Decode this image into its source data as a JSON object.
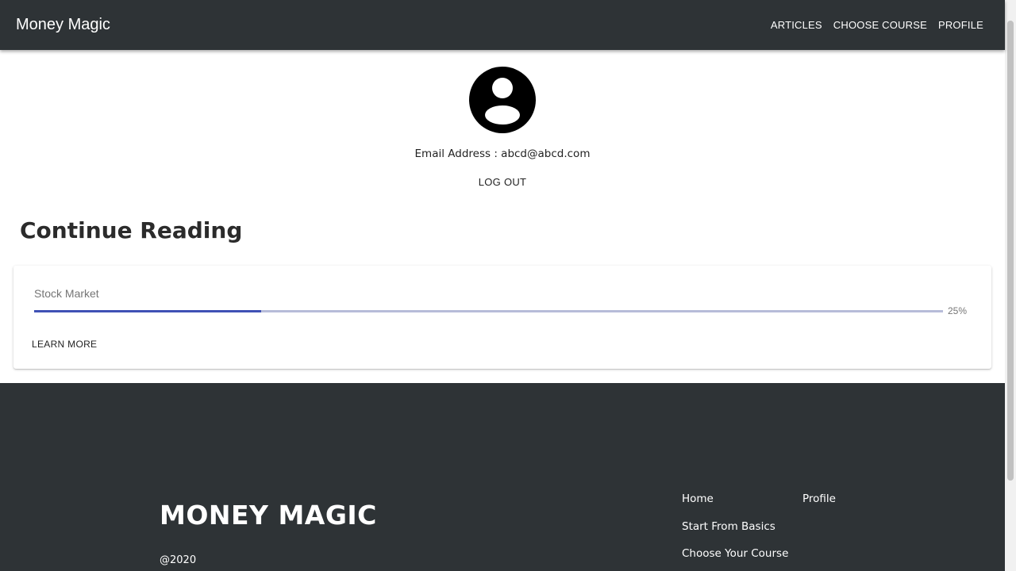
{
  "header": {
    "brand": "Money Magic",
    "nav": [
      "ARTICLES",
      "CHOOSE COURSE",
      "PROFILE"
    ]
  },
  "profile": {
    "avatar_icon": "account-circle-icon",
    "email_label": "Email Address :",
    "email_value": "abcd@abcd.com",
    "logout_label": "LOG OUT"
  },
  "continue_reading": {
    "title": "Continue Reading",
    "card": {
      "course_title": "Stock Market",
      "progress": 25,
      "progress_label": "25%",
      "learn_more_label": "LEARN MORE"
    }
  },
  "footer": {
    "brand": "MONEY MAGIC",
    "copyright": "@2020",
    "links": {
      "home": "Home",
      "start_basics": "Start From Basics",
      "choose_course": "Choose Your Course",
      "profile": "Profile"
    }
  },
  "colors": {
    "appbar": "#2e3336",
    "progress_fill": "#3f51b5",
    "progress_track": "#b7bcd9"
  }
}
